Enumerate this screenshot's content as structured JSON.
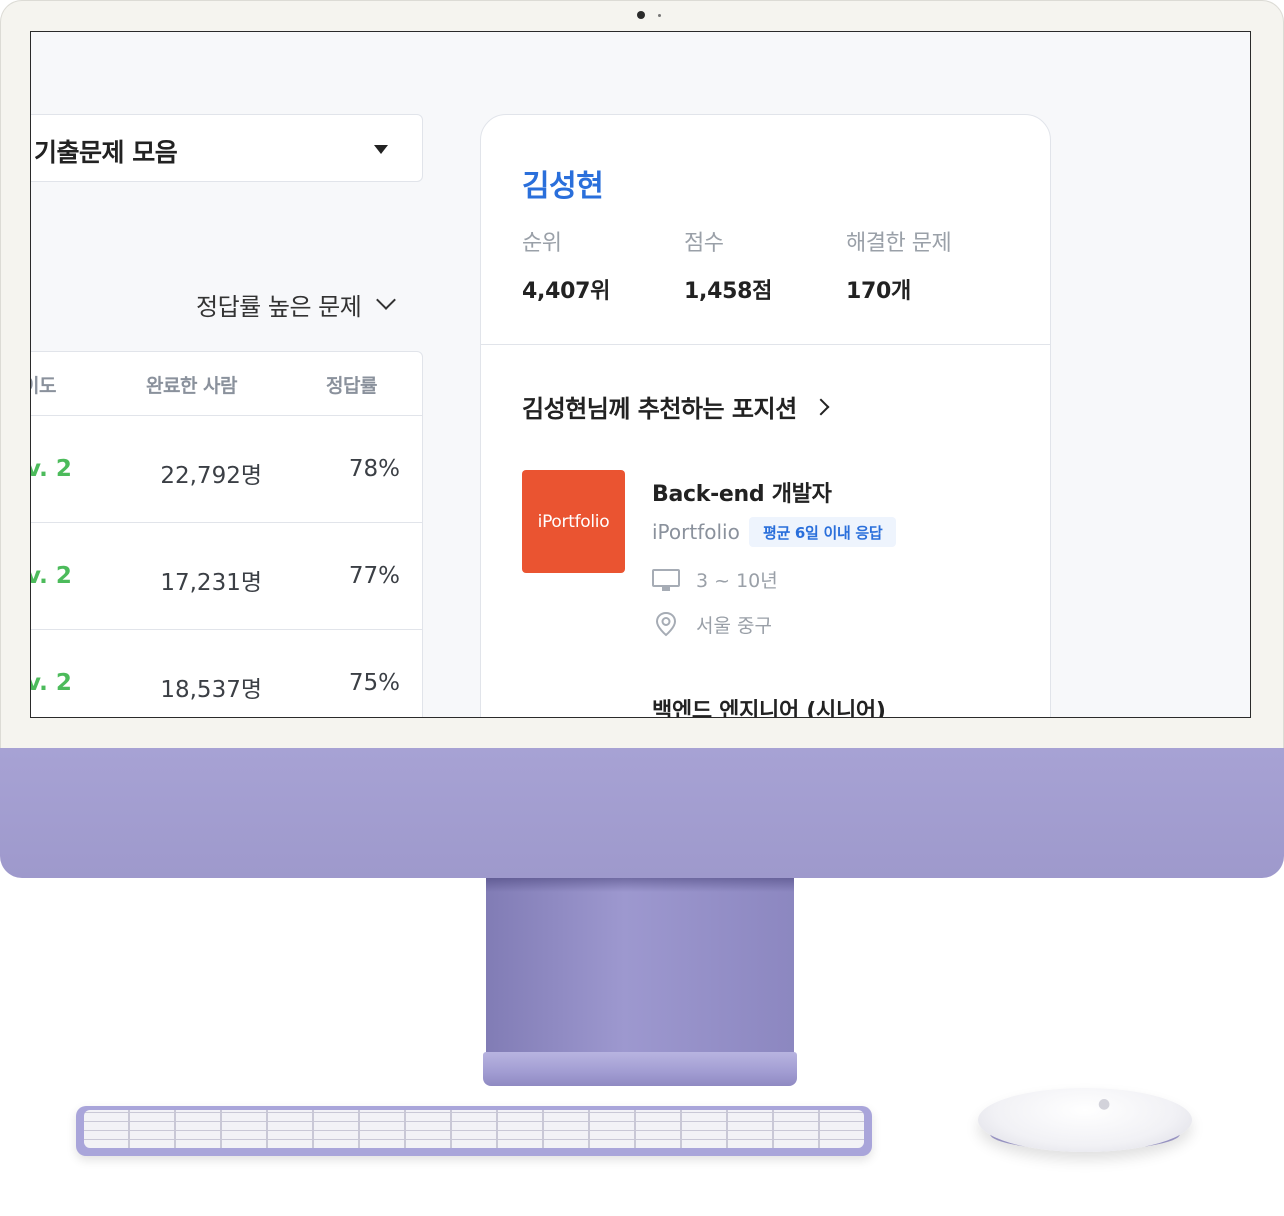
{
  "problem_set": {
    "dropdown_label": "기출문제 모음"
  },
  "sort": {
    "label": "정답률 높은 문제"
  },
  "table": {
    "headers": [
      "난이도",
      "완료한 사람",
      "정답률"
    ],
    "header_visible": [
      "이도",
      "완료한 사람",
      "정답률"
    ],
    "rows": [
      {
        "level": "v. 2",
        "completed": "22,792명",
        "rate": "78%"
      },
      {
        "level": "v. 2",
        "completed": "17,231명",
        "rate": "77%"
      },
      {
        "level": "v. 2",
        "completed": "18,537명",
        "rate": "75%"
      }
    ]
  },
  "profile": {
    "name": "김성현",
    "stats": [
      {
        "label": "순위",
        "value": "4,407위"
      },
      {
        "label": "점수",
        "value": "1,458점"
      },
      {
        "label": "해결한 문제",
        "value": "170개"
      }
    ]
  },
  "recommend": {
    "title": "김성현님께 추천하는 포지션",
    "jobs": [
      {
        "logo_text": "iPortfolio",
        "title": "Back-end 개발자",
        "company": "iPortfolio",
        "badge": "평균 6일 이내 응답",
        "experience": "3 ~ 10년",
        "location": "서울 중구"
      },
      {
        "title": "백엔드 엔지니어 (시니어)"
      }
    ]
  },
  "colors": {
    "accent_blue": "#2a6fdb",
    "level_green": "#4cbb5b",
    "logo_orange": "#ea5431",
    "device_purple": "#a7a2d4"
  },
  "icons": [
    "caret-down-icon",
    "chevron-down-icon",
    "chevron-right-icon",
    "monitor-icon",
    "location-pin-icon",
    "apple-logo-icon"
  ]
}
